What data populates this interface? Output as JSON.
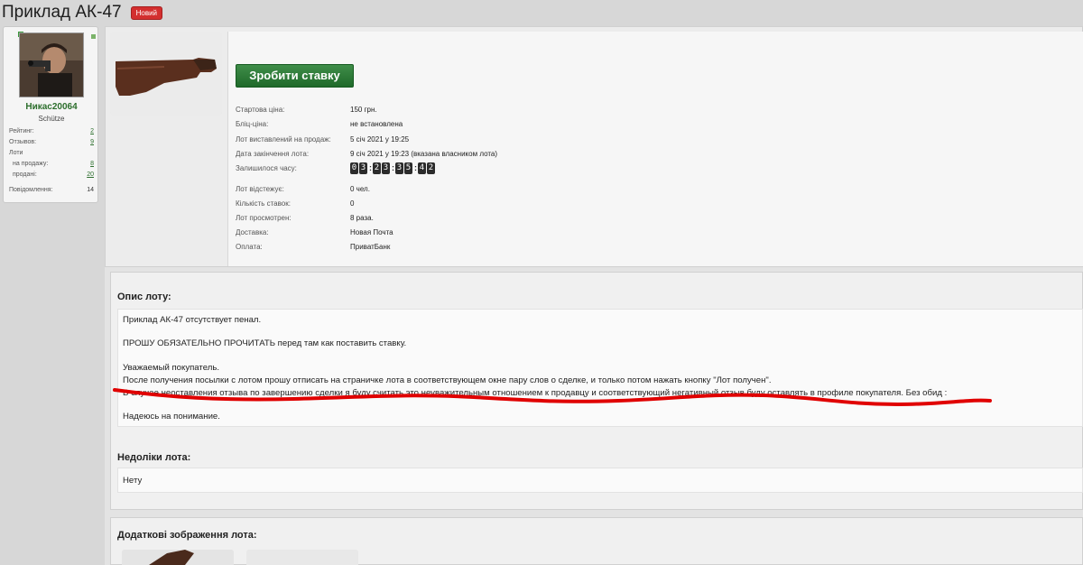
{
  "page": {
    "title": "Приклад АК-47",
    "badge": "Новий"
  },
  "user": {
    "name": "Никас20064",
    "title": "Schütze",
    "stats": [
      {
        "label": "Рейтинг:",
        "value": "2"
      },
      {
        "label": "Отзывов:",
        "value": "9"
      },
      {
        "label": "Лоти",
        "value": ""
      },
      {
        "label": "на продажу:",
        "value": "8"
      },
      {
        "label": "продані:",
        "value": "20"
      },
      {
        "label": "Повідомлення:",
        "value": "14"
      }
    ]
  },
  "lot": {
    "bid_button": "Зробити ставку",
    "start_price_label": "Стартова ціна:",
    "start_price": "150 грн.",
    "blitz_label": "Бліц-ціна:",
    "blitz": "не встановлена",
    "listed_label": "Лот виставлений на продаж:",
    "listed": "5 січ 2021 у 19:25",
    "ends_label": "Дата закінчення лота:",
    "ends": "9 січ 2021 у 19:23 (вказана власником лота)",
    "remaining_label": "Залишилося часу:",
    "timer": {
      "d1": "0",
      "d2": "3",
      "h1": "2",
      "h2": "3",
      "m1": "3",
      "m2": "5",
      "s1": "4",
      "s2": "2"
    },
    "watch_label": "Лот відстежує:",
    "watch": "0 чел.",
    "bids_label": "Кількість ставок:",
    "bids": "0",
    "views_label": "Лот просмотрен:",
    "views": "8 раза.",
    "delivery_label": "Доставка:",
    "delivery": "Новая Почта",
    "payment_label": "Оплата:",
    "payment": "ПриватБанк"
  },
  "description": {
    "title": "Опис лоту:",
    "lines": [
      "Приклад АК-47 отсутствует пенал.",
      "ПРОШУ ОБЯЗАТЕЛЬНО ПРОЧИТАТЬ перед там как поставить ставку.",
      "Уважаемый покупатель.",
      "После получения посылки с лотом прошу отписать на страничке лота в соответствующем окне пару слов о сделке, и только потом нажать кнопку \"Лот получен\".",
      "В случае неоставления отзыва по завершению сделки я буду считать это неуважительным отношением к продавцу и соответствующий негативный отзыв буду оставлять в профиле покупателя. Без обид :",
      "Надеюсь на понимание."
    ]
  },
  "defects": {
    "title": "Недоліки лота:",
    "text": "Нету"
  },
  "images": {
    "title": "Додаткові зображення лота:"
  },
  "colors": {
    "bid_button": "#2f7d3a",
    "badge": "#d32f2f",
    "annotation": "#e00000",
    "username": "#2c6e2c"
  }
}
